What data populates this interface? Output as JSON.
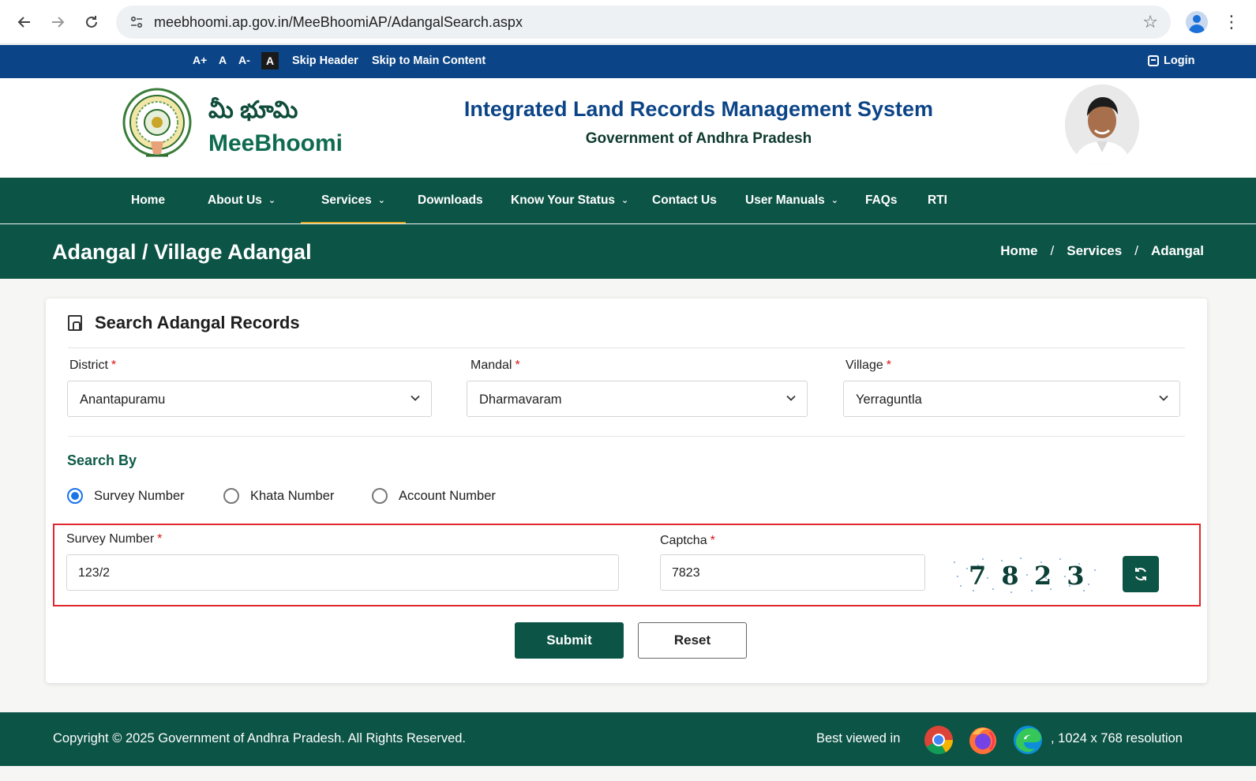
{
  "browser": {
    "url": "meebhoomi.ap.gov.in/MeeBhoomiAP/AdangalSearch.aspx"
  },
  "topbar": {
    "font_increase": "A+",
    "font_normal": "A",
    "font_decrease": "A-",
    "font_contrast": "A",
    "skip_header": "Skip Header",
    "skip_main": "Skip to Main Content",
    "login": "Login"
  },
  "header": {
    "logo_telugu": "మీ భూమి",
    "logo_english": "MeeBhoomi",
    "title": "Integrated Land Records Management System",
    "subtitle": "Government of Andhra Pradesh"
  },
  "nav": {
    "items": [
      {
        "label": "Home",
        "dropdown": false
      },
      {
        "label": "About Us",
        "dropdown": true
      },
      {
        "label": "Services",
        "dropdown": true,
        "active": true
      },
      {
        "label": "Downloads",
        "dropdown": false
      },
      {
        "label": "Know Your Status",
        "dropdown": true
      },
      {
        "label": "Contact Us",
        "dropdown": false
      },
      {
        "label": "User Manuals",
        "dropdown": true
      },
      {
        "label": "FAQs",
        "dropdown": false
      },
      {
        "label": "RTI",
        "dropdown": false
      }
    ]
  },
  "page": {
    "title": "Adangal / Village Adangal",
    "breadcrumb": [
      "Home",
      "Services",
      "Adangal"
    ]
  },
  "form": {
    "heading": "Search Adangal Records",
    "district_label": "District",
    "district_value": "Anantapuramu",
    "mandal_label": "Mandal",
    "mandal_value": "Dharmavaram",
    "village_label": "Village",
    "village_value": "Yerraguntla",
    "required_mark": "*",
    "search_by_label": "Search By",
    "radio_options": [
      "Survey Number",
      "Khata Number",
      "Account Number"
    ],
    "selected_option": "Survey Number",
    "survey_label": "Survey Number",
    "survey_value": "123/2",
    "captcha_label": "Captcha",
    "captcha_value": "7823",
    "captcha_image_text": "7 8 2 3",
    "submit": "Submit",
    "reset": "Reset"
  },
  "footer": {
    "copyright": "Copyright © 2025 Government of Andhra Pradesh. All Rights Reserved.",
    "best_viewed": "Best viewed in",
    "resolution": ", 1024 x 768 resolution"
  },
  "colors": {
    "primary_green": "#0c5446",
    "top_blue": "#0c4587",
    "highlight_red": "#e0282e"
  }
}
